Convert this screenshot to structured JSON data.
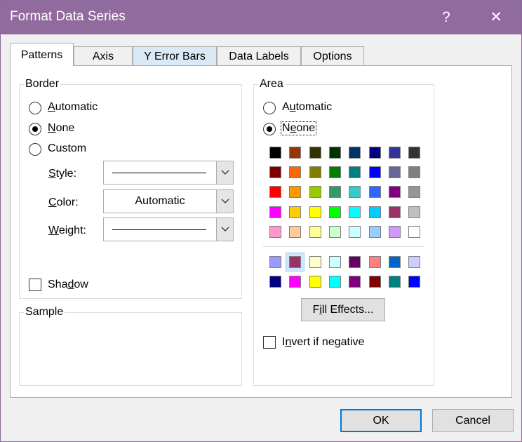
{
  "window": {
    "title": "Format Data Series",
    "help_glyph": "?",
    "close_glyph": "✕"
  },
  "tabs": [
    {
      "label": "Patterns",
      "active": true
    },
    {
      "label": "Axis"
    },
    {
      "label": "Y Error Bars",
      "hover": true
    },
    {
      "label": "Data Labels"
    },
    {
      "label": "Options"
    }
  ],
  "border": {
    "title": "Border",
    "options": [
      {
        "label": "Automatic",
        "checked": false
      },
      {
        "label": "None",
        "checked": true
      },
      {
        "label": "Custom",
        "checked": false
      }
    ],
    "style_label": "Style:",
    "color_label": "Color:",
    "color_value": "Automatic",
    "weight_label": "Weight:",
    "shadow_label": "Shadow",
    "shadow_checked": false
  },
  "sample": {
    "title": "Sample"
  },
  "area": {
    "title": "Area",
    "options": [
      {
        "label": "Automatic",
        "checked": false
      },
      {
        "label": "None",
        "checked": true
      }
    ],
    "palette_main": [
      [
        "#000000",
        "#993300",
        "#333300",
        "#003300",
        "#003366",
        "#000080",
        "#333399",
        "#333333"
      ],
      [
        "#800000",
        "#FF6600",
        "#808000",
        "#008000",
        "#008080",
        "#0000FF",
        "#666699",
        "#808080"
      ],
      [
        "#FF0000",
        "#FF9900",
        "#99CC00",
        "#339966",
        "#33CCCC",
        "#3366FF",
        "#800080",
        "#969696"
      ],
      [
        "#FF00FF",
        "#FFCC00",
        "#FFFF00",
        "#00FF00",
        "#00FFFF",
        "#00CCFF",
        "#993366",
        "#C0C0C0"
      ],
      [
        "#FF99CC",
        "#FFCC99",
        "#FFFF99",
        "#CCFFCC",
        "#CCFFFF",
        "#99CCFF",
        "#CC99FF",
        "#FFFFFF"
      ]
    ],
    "palette_chart": [
      [
        "#9999FF",
        "#993366",
        "#FFFFCC",
        "#CCFFFF",
        "#660066",
        "#FF8080",
        "#0066CC",
        "#CCCCFF"
      ],
      [
        "#000080",
        "#FF00FF",
        "#FFFF00",
        "#00FFFF",
        "#800080",
        "#800000",
        "#008080",
        "#0000FF"
      ]
    ],
    "fill_effects_label": "Fill Effects...",
    "invert_label": "Invert if negative",
    "invert_checked": false
  },
  "footer": {
    "ok_label": "OK",
    "cancel_label": "Cancel"
  }
}
